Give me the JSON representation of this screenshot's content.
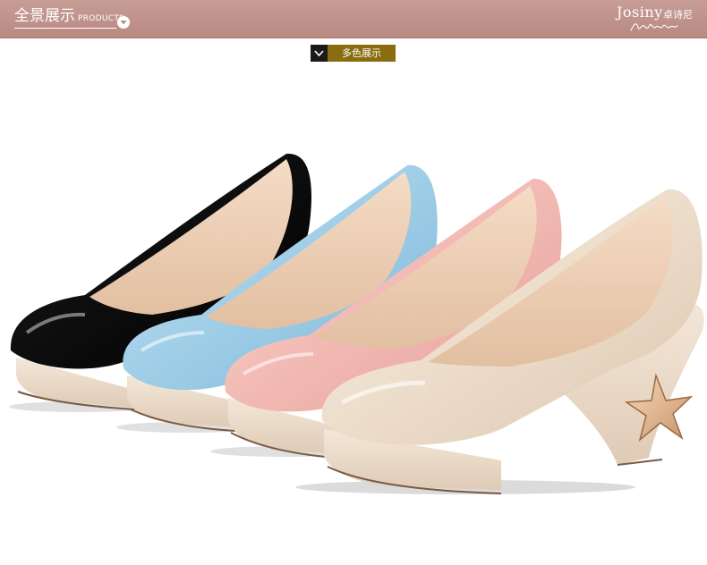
{
  "banner": {
    "title_cn": "全景展示",
    "title_en": "PRODUCTS",
    "brand": "Josiny",
    "brand_cn": "卓诗尼"
  },
  "tag": {
    "label": "多色展示"
  },
  "icons": {
    "banner_icon": "chevron-down-circle-icon",
    "tag_icon": "chevron-down-icon"
  },
  "colors": {
    "banner": "#c09390",
    "tag_label": "#8a6d10",
    "shoes": [
      "#111111",
      "#a8d3ea",
      "#f2b8b4",
      "#eeddc9"
    ]
  }
}
